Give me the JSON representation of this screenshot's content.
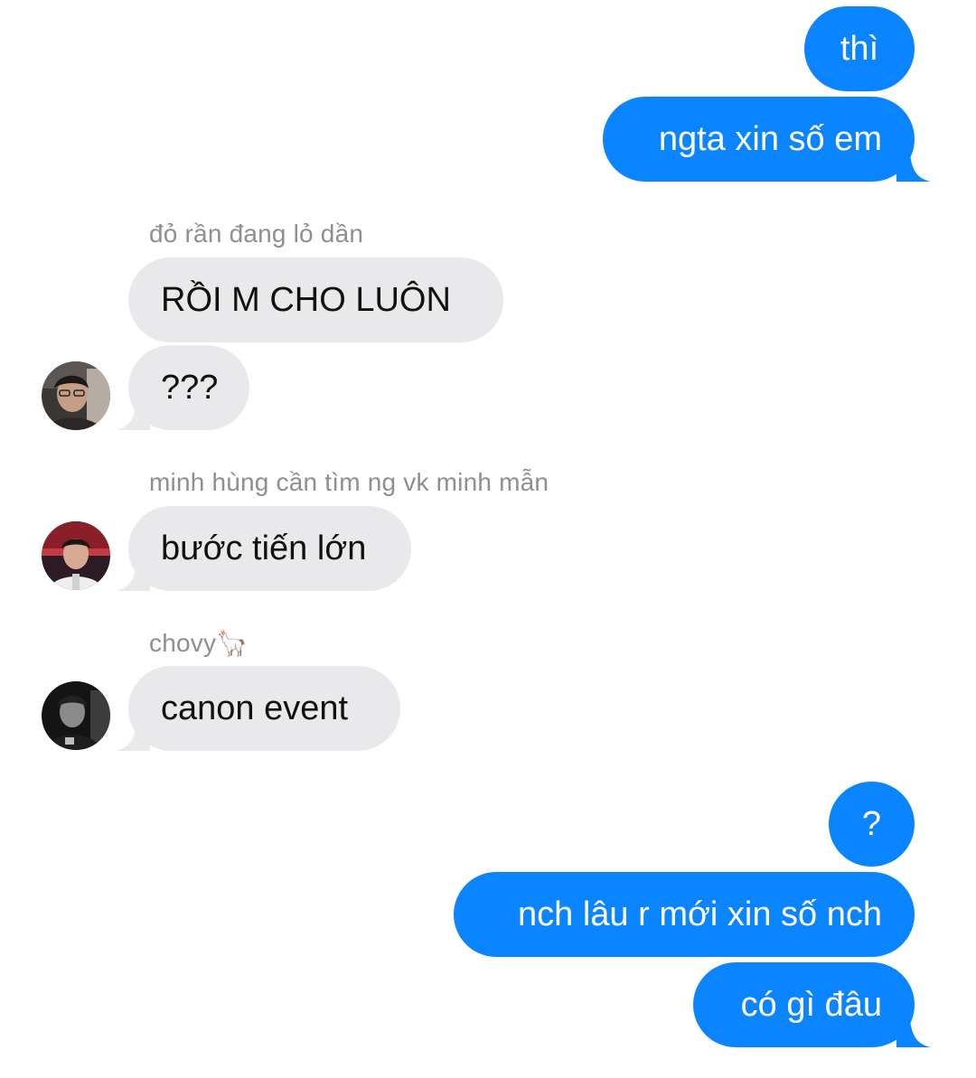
{
  "messages": [
    {
      "id": "m1",
      "direction": "outgoing",
      "text": "thì"
    },
    {
      "id": "m2",
      "direction": "outgoing",
      "text": "ngta xin số em"
    },
    {
      "id": "m3",
      "direction": "incoming",
      "sender": "đỏ rần đang lỏ dần",
      "text": "RỒI M CHO LUÔN"
    },
    {
      "id": "m4",
      "direction": "incoming",
      "text": "???",
      "avatar": "avatar-photo"
    },
    {
      "id": "m5",
      "direction": "incoming",
      "sender": "minh hùng cần tìm ng vk minh mẫn",
      "text": "bước tiến lớn",
      "avatar": "avatar-photo"
    },
    {
      "id": "m6",
      "direction": "incoming",
      "sender": "chovy",
      "sender_emoji": "🦙",
      "text": "canon event",
      "avatar": "avatar-photo"
    },
    {
      "id": "m7",
      "direction": "outgoing",
      "text": "?"
    },
    {
      "id": "m8",
      "direction": "outgoing",
      "text": "nch lâu r mới xin số nch"
    },
    {
      "id": "m9",
      "direction": "outgoing",
      "text": "có gì đâu"
    }
  ],
  "colors": {
    "outgoing_bubble": "#0a84ff",
    "incoming_bubble": "#e9e9eb",
    "sender_name": "#8e8e93",
    "background": "#ffffff"
  }
}
